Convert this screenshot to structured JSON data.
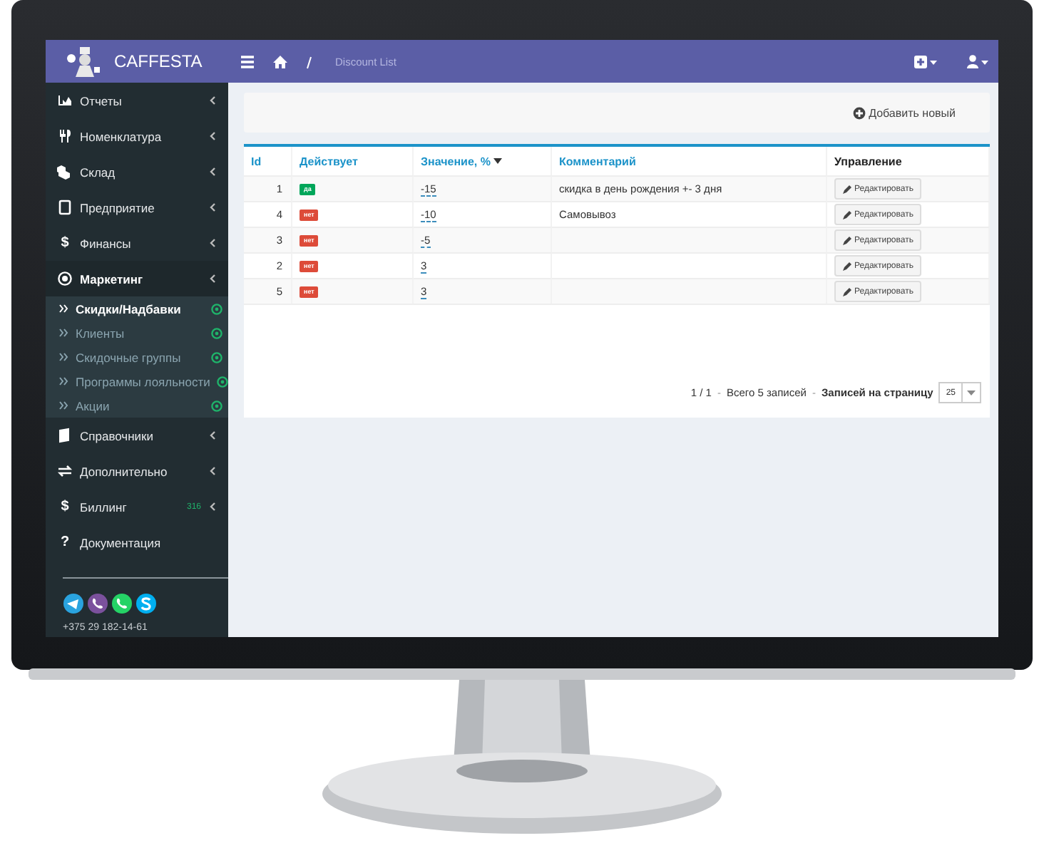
{
  "app": {
    "logo_text": "CAFFESTA"
  },
  "sidebar": {
    "items": [
      {
        "label": "Отчеты",
        "selected": false
      },
      {
        "label": "Номенклатура",
        "selected": false
      },
      {
        "label": "Склад",
        "selected": false
      },
      {
        "label": "Предприятие",
        "selected": false
      },
      {
        "label": "Финансы",
        "glyph": "$",
        "selected": false
      },
      {
        "label": "Маркетинг",
        "selected": true,
        "children": [
          {
            "label": "Скидки/Надбавки",
            "selected": true
          },
          {
            "label": "Клиенты",
            "selected": false
          },
          {
            "label": "Скидочные группы",
            "selected": false
          },
          {
            "label": "Программы лояльности",
            "selected": false
          },
          {
            "label": "Акции",
            "selected": false
          }
        ]
      },
      {
        "label": "Справочники",
        "selected": false
      },
      {
        "label": "Дополнительно",
        "selected": false
      },
      {
        "label": "Биллинг",
        "glyph": "$",
        "badge": "316",
        "selected": false
      },
      {
        "label": "Документация",
        "glyph": "?",
        "selected": false
      }
    ],
    "phone": "+375 29 182-14-61"
  },
  "header": {
    "breadcrumb": "Discount List"
  },
  "toolbar": {
    "add_button": "Добавить новый"
  },
  "table": {
    "columns": [
      "Id",
      "Действует",
      "Значение, %",
      "Комментарий",
      "Управление"
    ],
    "rows": [
      {
        "id": "1",
        "active": true,
        "active_label": "да",
        "value": "-15",
        "comment": "скидка в день рождения +- 3 дня",
        "action": "Редактировать"
      },
      {
        "id": "4",
        "active": false,
        "active_label": "нет",
        "value": "-10",
        "comment": "Самовывоз",
        "action": "Редактировать"
      },
      {
        "id": "3",
        "active": false,
        "active_label": "нет",
        "value": "-5",
        "action": "Редактировать"
      },
      {
        "id": "2",
        "active": false,
        "active_label": "нет",
        "value": "3",
        "action": "Редактировать"
      },
      {
        "id": "5",
        "active": false,
        "active_label": "нет",
        "value": "3",
        "action": "Редактировать"
      }
    ]
  },
  "pagination": {
    "pages": "1 / 1",
    "total": "Всего 5 записей",
    "per_page_label": "Записей на страницу",
    "per_page": "25",
    "separator": "-"
  }
}
